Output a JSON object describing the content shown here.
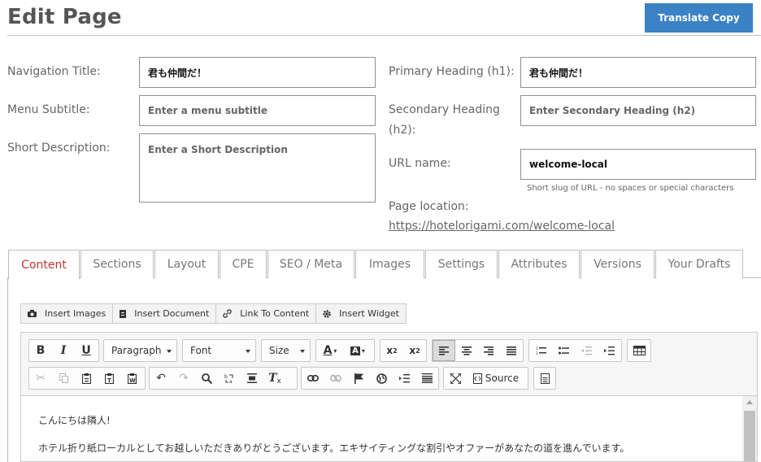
{
  "header": {
    "title": "Edit Page",
    "translate_button": "Translate Copy"
  },
  "form": {
    "nav_title": {
      "label": "Navigation Title:",
      "value": "君も仲間だ！"
    },
    "menu_subtitle": {
      "label": "Menu Subtitle:",
      "placeholder": "Enter a menu subtitle"
    },
    "short_description": {
      "label": "Short Description:",
      "placeholder": "Enter a Short Description"
    },
    "primary_heading": {
      "label": "Primary Heading (h1):",
      "value": "君も仲間だ！"
    },
    "secondary_heading": {
      "label_line1": "Secondary Heading",
      "label_line2": "(h2):",
      "placeholder": "Enter Secondary Heading (h2)"
    },
    "url_name": {
      "label": "URL name:",
      "value": "welcome-local",
      "hint": "Short slug of URL - no spaces or special characters"
    },
    "page_location": {
      "label": "Page location:",
      "url": "https://hotelorigami.com/welcome-local"
    }
  },
  "tabs": [
    "Content",
    "Sections",
    "Layout",
    "CPE",
    "SEO / Meta",
    "Images",
    "Settings",
    "Attributes",
    "Versions",
    "Your Drafts"
  ],
  "active_tab": "Content",
  "insert_bar": {
    "images": "Insert Images",
    "document": "Insert Document",
    "link": "Link To Content",
    "widget": "Insert Widget"
  },
  "editor": {
    "format_combo": "Paragraph",
    "font_combo": "Font",
    "size_combo": "Size",
    "source_label": "Source",
    "content": [
      "こんにちは隣人!",
      "ホテル折り紙ローカルとしてお越しいただきありがとうございます。エキサイティングな割引やオファーがあなたの道を進んでいます。"
    ]
  },
  "colors": {
    "accent_blue": "#3b82c4",
    "active_tab": "#c4342d"
  }
}
